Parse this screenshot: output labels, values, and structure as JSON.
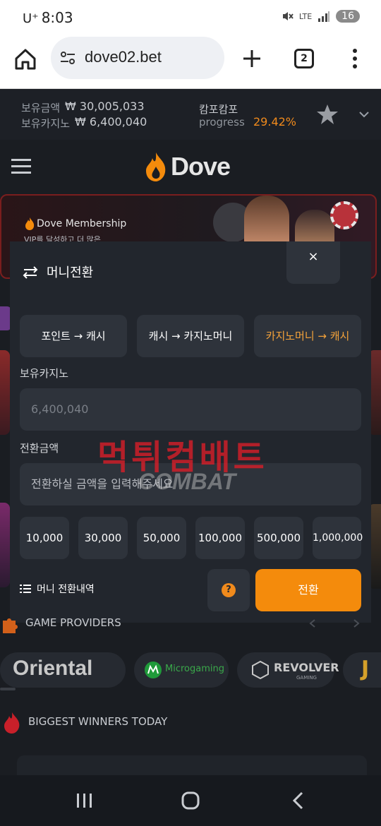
{
  "status_bar": {
    "time": "8:03",
    "carrier": "U⁺",
    "network": "LTE",
    "battery": "16"
  },
  "browser": {
    "url": "dove02.bet",
    "tab_count": "2"
  },
  "header": {
    "held_amount_label": "보유금액",
    "held_amount_value": "₩ 30,005,033",
    "held_casino_label": "보유카지노",
    "held_casino_value": "₩ 6,400,040",
    "campcampo_label": "캄포캄포",
    "progress_label": "progress",
    "progress_value": "29.42%"
  },
  "site": {
    "logo_text": "Dove",
    "banner_brand": "Dove Membership",
    "banner_sub": "VIP를 달성하고 더 많은"
  },
  "modal": {
    "title": "머니전환",
    "close_label": "×",
    "tabs": [
      {
        "label": "포인트 → 캐시"
      },
      {
        "label": "캐시 → 카지노머니"
      },
      {
        "label": "카지노머니 → 캐시"
      }
    ],
    "casino_label": "보유카지노",
    "casino_value": "6,400,040",
    "amount_label": "전환금액",
    "amount_placeholder": "전환하실 금액을 입력해주세요",
    "amount_buttons": [
      "10,000",
      "30,000",
      "50,000",
      "100,000",
      "500,000",
      "1,000,000"
    ],
    "history_label": "머니 전환내역",
    "help_label": "?",
    "convert_label": "전환"
  },
  "watermark": {
    "korean": "먹튀컴배트",
    "english": "COMBAT"
  },
  "sections": {
    "providers_title": "GAME PROVIDERS",
    "providers": [
      "Oriental",
      "Microgaming",
      "REVOLVER"
    ],
    "revolver_sub": "GAMING",
    "winners_title": "BIGGEST WINNERS TODAY"
  },
  "colors": {
    "accent": "#f48b0c",
    "modal_bg": "#22262d",
    "button_bg": "#2e333b",
    "page_bg": "#1a1d22"
  }
}
